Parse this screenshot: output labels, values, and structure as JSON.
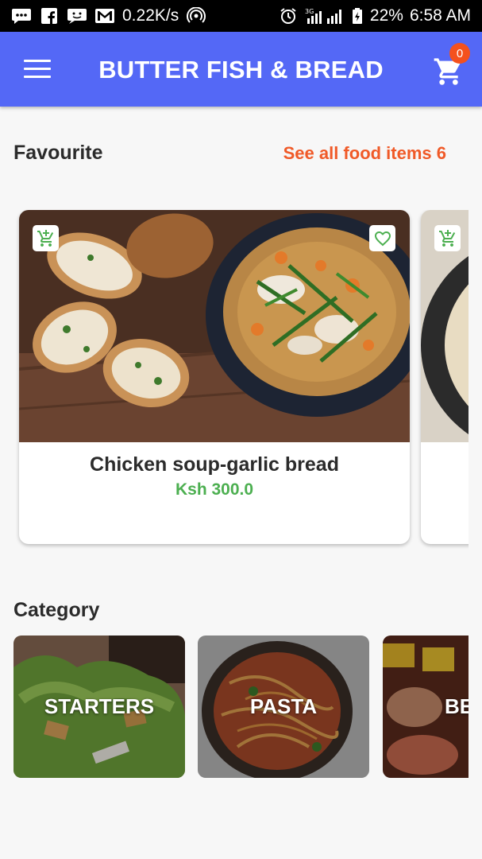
{
  "status_bar": {
    "speed": "0.22K/s",
    "network": "3G",
    "battery": "22%",
    "time": "6:58 AM"
  },
  "app_bar": {
    "title": "BUTTER FISH & BREAD",
    "cart_count": "0"
  },
  "favourite": {
    "title": "Favourite",
    "see_all": "See all food items 6",
    "items": [
      {
        "name": "Chicken soup-garlic bread",
        "price": "Ksh 300.0"
      }
    ]
  },
  "category": {
    "title": "Category",
    "items": [
      {
        "label": "STARTERS"
      },
      {
        "label": "PASTA"
      },
      {
        "label": "BE"
      }
    ]
  },
  "colors": {
    "app_bar": "#5468f6",
    "accent": "#f05a28",
    "price": "#4caf50",
    "badge": "#f4511e"
  },
  "icons": [
    "menu-icon",
    "cart-icon",
    "add-to-cart-icon",
    "heart-icon"
  ]
}
